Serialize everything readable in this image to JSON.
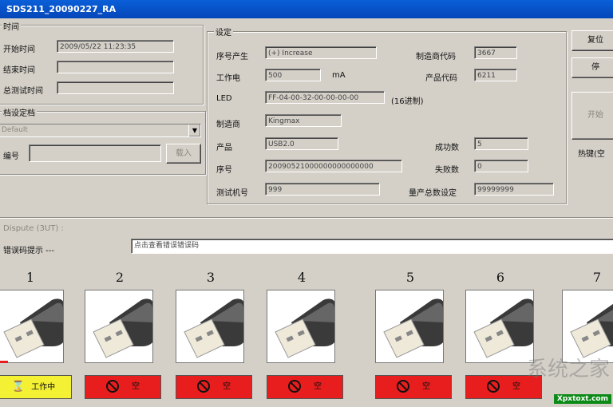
{
  "window": {
    "title": "SDS211_20090227_RA"
  },
  "time_group": {
    "title": "时间",
    "start_label": "开始时间",
    "start_value": "2009/05/22 11:23:35",
    "end_label": "结束时间",
    "end_value": "",
    "total_label": "总测试时间",
    "total_value": ""
  },
  "settings_group": {
    "title": "设定",
    "serial_gen_label": "序号产生",
    "serial_gen_value": "(+) Increase",
    "current_label": "工作电",
    "current_value": "500",
    "current_unit": "mA",
    "led_label": "LED",
    "led_value": "FF-04-00-32-00-00-00-00",
    "led_note": "(16进制)",
    "vendor_label": "制造商",
    "vendor_value": "Kingmax",
    "product_label": "产品",
    "product_value": "USB2.0",
    "serial_label": "序号",
    "serial_value": "20090521000000000000000",
    "tester_label": "测试机号",
    "tester_value": "999",
    "vid_label": "制造商代码",
    "vid_value": "3667",
    "pid_label": "产品代码",
    "pid_value": "6211",
    "success_label": "成功数",
    "success_value": "5",
    "fail_label": "失败数",
    "fail_value": "0",
    "total_label": "量产总数设定",
    "total_value": "99999999"
  },
  "config_group": {
    "title": "档设定档",
    "combo_value": "Default",
    "code_label": "编号",
    "code_value": "",
    "load_button": "载入"
  },
  "right_buttons": {
    "btn1": "复位",
    "btn2": "停",
    "btn3": "开始",
    "hotkey_label": "热键(空"
  },
  "section_label": "Dispute (3UT) :",
  "hint_label": "错误码提示 ---",
  "hint_value": "点击查看错误错误码",
  "slots": [
    {
      "num": "1",
      "status": "工作中",
      "state": "working"
    },
    {
      "num": "2",
      "status": "空",
      "state": "empty"
    },
    {
      "num": "3",
      "status": "空",
      "state": "empty"
    },
    {
      "num": "4",
      "status": "空",
      "state": "empty"
    },
    {
      "num": "5",
      "status": "空",
      "state": "empty"
    },
    {
      "num": "6",
      "status": "空",
      "state": "empty"
    },
    {
      "num": "7",
      "status": "",
      "state": "partial"
    }
  ],
  "watermark": {
    "text": "系统之家",
    "url": "Xpxtoxt.com"
  },
  "colors": {
    "working": "#f4f034",
    "empty": "#e81d1d",
    "titlebar": "#0546b8"
  }
}
